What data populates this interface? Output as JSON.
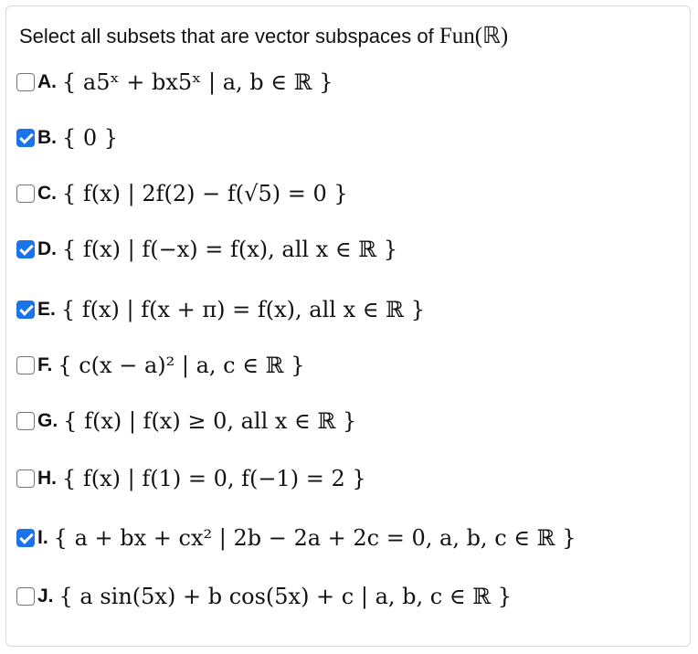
{
  "question": {
    "prefix": "Select all subsets that are vector subspaces of ",
    "space": "Fun(ℝ)"
  },
  "options": [
    {
      "letter": "A.",
      "checked": false,
      "math": "{ a5ˣ + bx5ˣ | a, b ∈ ℝ }"
    },
    {
      "letter": "B.",
      "checked": true,
      "math": "{ 0 }"
    },
    {
      "letter": "C.",
      "checked": false,
      "math": "{ f(x) | 2f(2) − f(√5) = 0 }"
    },
    {
      "letter": "D.",
      "checked": true,
      "math": "{ f(x) | f(−x) = f(x),  all x ∈ ℝ }"
    },
    {
      "letter": "E.",
      "checked": true,
      "math": "{ f(x) | f(x + π) = f(x),  all x ∈ ℝ }"
    },
    {
      "letter": "F.",
      "checked": false,
      "math": "{ c(x − a)² | a, c ∈ ℝ }"
    },
    {
      "letter": "G.",
      "checked": false,
      "math": "{ f(x) | f(x) ≥ 0,  all x ∈ ℝ }"
    },
    {
      "letter": "H.",
      "checked": false,
      "math": "{ f(x) | f(1) = 0,  f(−1) = 2 }"
    },
    {
      "letter": "I.",
      "checked": true,
      "math": "{ a + bx + cx² | 2b − 2a + 2c = 0,  a, b, c ∈ ℝ }"
    },
    {
      "letter": "J.",
      "checked": false,
      "math": "{ a sin(5x) + b cos(5x) + c | a, b, c ∈ ℝ }"
    }
  ]
}
